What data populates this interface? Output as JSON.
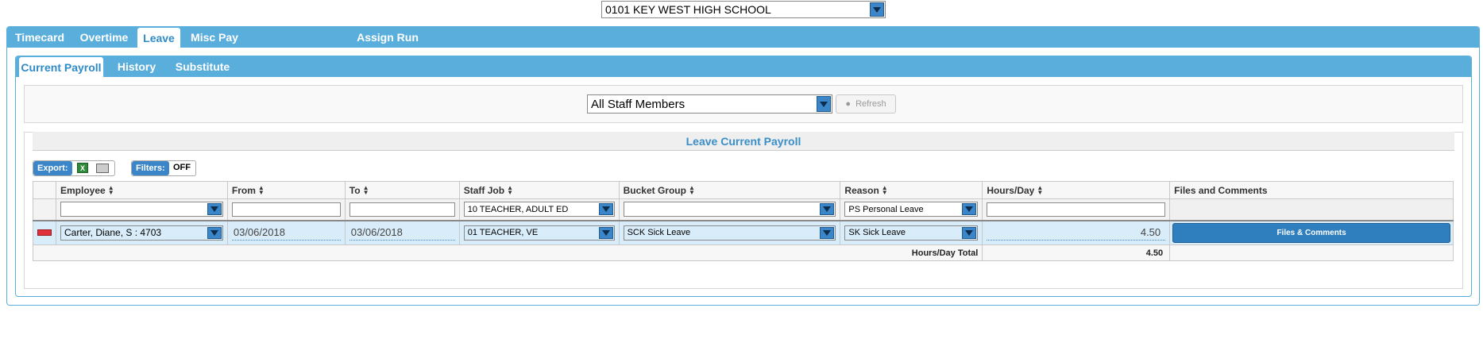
{
  "school_select": {
    "value": "0101 KEY WEST HIGH SCHOOL"
  },
  "main_tabs": [
    {
      "label": "Timecard"
    },
    {
      "label": "Overtime"
    },
    {
      "label": "Leave"
    },
    {
      "label": "Misc Pay"
    },
    {
      "label": "Assign Run"
    }
  ],
  "sub_tabs": [
    {
      "label": "Current Payroll"
    },
    {
      "label": "History"
    },
    {
      "label": "Substitute"
    }
  ],
  "staff_filter": {
    "value": "All Staff Members",
    "refresh_label": "Refresh"
  },
  "section_title": "Leave Current Payroll",
  "toolbar": {
    "export_label": "Export:",
    "filters_label": "Filters:",
    "filters_state": "OFF"
  },
  "columns": {
    "employee": "Employee",
    "from": "From",
    "to": "To",
    "staff_job": "Staff Job",
    "bucket_group": "Bucket Group",
    "reason": "Reason",
    "hours_day": "Hours/Day",
    "files": "Files and Comments"
  },
  "filter_row": {
    "employee": "",
    "staff_job": "10 TEACHER, ADULT ED",
    "bucket_group": "",
    "reason": "PS Personal Leave"
  },
  "rows": [
    {
      "employee": "Carter, Diane, S : 4703",
      "from": "03/06/2018",
      "to": "03/06/2018",
      "staff_job": "01 TEACHER, VE",
      "bucket_group": "SCK Sick Leave",
      "reason": "SK Sick Leave",
      "hours_day": "4.50",
      "files_button": "Files & Comments"
    }
  ],
  "totals": {
    "label": "Hours/Day Total",
    "value": "4.50"
  }
}
